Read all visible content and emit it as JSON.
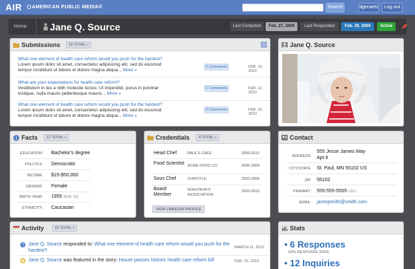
{
  "header": {
    "logo": "AIR",
    "org": "AMERICAN PUBLIC MEDIA",
    "trademark": "®",
    "search_placeholder": "",
    "search_label": "Search",
    "user_label": "dgeraets",
    "logout_label": "Log out",
    "brand_color": "#5a7fc2"
  },
  "crumb": {
    "home": "Home",
    "name": "Jane Q. Source",
    "last_contacted_label": "Last Contacted",
    "last_contacted_date": "Feb. 27, 2009",
    "last_responded_label": "Last Responded",
    "last_responded_date": "Feb. 29, 2009",
    "status": "Active",
    "status_color": "#2ea43a",
    "responded_color": "#2c77b6"
  },
  "submissions": {
    "title": "Submissions",
    "count": "19 TOTAL »",
    "items": [
      {
        "question": "What one element of health care reform would you push for the hardest?",
        "line1": "Lorem ipsum dolor sit amet, consectetur adipisicing elit, sed do eiusmod",
        "line2": "tempor incididunt ut labore et dolore magna aliqua...",
        "more": "More »",
        "comments": "2 Comments",
        "date": "FEB. 15, 2010"
      },
      {
        "question": "What are your expectations for health care reform?",
        "line1": "Vestibulum in leo a nibh molestie luctus. Ut imperdiet, purus in pulvinar",
        "line2": "tristique, nulla mauris pellentesque mauris...",
        "more": "More »",
        "comments": "1 Comments",
        "date": "FEB. 11, 2010"
      },
      {
        "question": "What one element of health care reform would you push for the hardest?",
        "line1": "Lorem ipsum dolor sit amet, consectetur adipisicing elit, sed do eiusmod",
        "line2": "tempor incididunt ut labore et dolore magna aliqua...",
        "more": "More »",
        "comments": "0 Comments",
        "date": "FEB. 15, 2010"
      }
    ]
  },
  "photo": {
    "title": "Jane Q. Source"
  },
  "facts": {
    "title": "Facts",
    "count": "12 TOTAL »",
    "rows": [
      {
        "label": "EDUCATION",
        "value": "Bachelor's degree"
      },
      {
        "label": "POLITICS",
        "value": "Democratic"
      },
      {
        "label": "INCOME",
        "value": "$15-$50,000"
      },
      {
        "label": "GENDER",
        "value": "Female"
      },
      {
        "label": "BIRTH YEAR",
        "value": "1955",
        "note": "[AGE: 55]"
      },
      {
        "label": "ETHNICITY",
        "value": "Caucasian"
      }
    ]
  },
  "credentials": {
    "title": "Credentials",
    "count": "4 TOTAL »",
    "rows": [
      {
        "role": "Head Chef",
        "org": "PAUL'S CAFE",
        "years": "2009-2010"
      },
      {
        "role": "Food Scientist",
        "org": "ACME FOOD CO.",
        "years": "2006-2009"
      },
      {
        "role": "Sous Chef",
        "org": "CHIPOTLE",
        "years": "2003-2006"
      },
      {
        "role": "Board Member",
        "org": "NON-PROFIT ASSOCIATION",
        "years": "2003-2010"
      }
    ],
    "linkedin": "VIEW LINKEDIN PROFILE"
  },
  "contact": {
    "title": "Contact",
    "rows": [
      {
        "label": "ADDRESS",
        "value": "555 Jesse James Way",
        "value2": "Apt 6"
      },
      {
        "label": "CITY/STATE",
        "value": "St. Paul, MN 55102 US"
      },
      {
        "label": "ZIP",
        "value": "55102"
      },
      {
        "label": "PRIMARY",
        "value": "555-555-5555",
        "note": "CELL"
      },
      {
        "label": "EMAIL",
        "value": "janeqsmith@smith.com"
      }
    ]
  },
  "activity": {
    "title": "Activity",
    "count": "15 TOTAL »",
    "items": [
      {
        "name": "Jane Q. Source",
        "verb": "responded to:",
        "link": "What one element of health care reform would you push for the",
        "link2": "hardest?",
        "date": "MARCH 11, 2010"
      },
      {
        "name": "Jane Q. Source",
        "verb": "was featured in the story:",
        "link": "House passes historic health care reform bill",
        "date": "FEB. 15, 2010"
      }
    ]
  },
  "stats": {
    "title": "Stats",
    "responses": "6 Responses",
    "response_rate": "50% RESPONSE RATE",
    "inquiries": "12 Inquiries"
  }
}
